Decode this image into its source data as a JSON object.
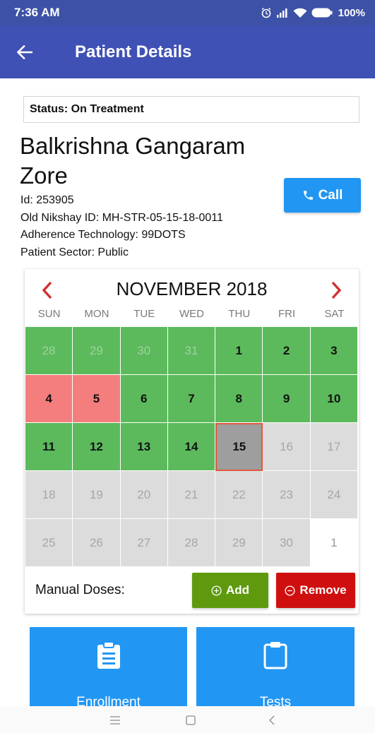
{
  "status_bar": {
    "time": "7:36 AM",
    "battery": "100%"
  },
  "app_bar": {
    "title": "Patient Details",
    "back_icon": "arrow-left-icon"
  },
  "patient": {
    "status": "Status: On Treatment",
    "name": "Balkrishna Gangaram Zore",
    "id": "Id: 253905",
    "old_nikshay_id": "Old Nikshay ID: MH-STR-05-15-18-0011",
    "adherence_technology": "Adherence Technology: 99DOTS",
    "sector": "Patient Sector: Public",
    "call_label": "Call"
  },
  "calendar": {
    "month_label": "NOVEMBER 2018",
    "weekdays": [
      "SUN",
      "MON",
      "TUE",
      "WED",
      "THU",
      "FRI",
      "SAT"
    ],
    "days": [
      {
        "label": "28",
        "state": "green muted"
      },
      {
        "label": "29",
        "state": "green muted"
      },
      {
        "label": "30",
        "state": "green muted"
      },
      {
        "label": "31",
        "state": "green muted"
      },
      {
        "label": "1",
        "state": "green"
      },
      {
        "label": "2",
        "state": "green"
      },
      {
        "label": "3",
        "state": "green"
      },
      {
        "label": "4",
        "state": "red"
      },
      {
        "label": "5",
        "state": "red"
      },
      {
        "label": "6",
        "state": "green"
      },
      {
        "label": "7",
        "state": "green"
      },
      {
        "label": "8",
        "state": "green"
      },
      {
        "label": "9",
        "state": "green"
      },
      {
        "label": "10",
        "state": "green"
      },
      {
        "label": "11",
        "state": "green"
      },
      {
        "label": "12",
        "state": "green"
      },
      {
        "label": "13",
        "state": "green"
      },
      {
        "label": "14",
        "state": "green"
      },
      {
        "label": "15",
        "state": "today"
      },
      {
        "label": "16",
        "state": "gray"
      },
      {
        "label": "17",
        "state": "gray"
      },
      {
        "label": "18",
        "state": "gray"
      },
      {
        "label": "19",
        "state": "gray"
      },
      {
        "label": "20",
        "state": "gray"
      },
      {
        "label": "21",
        "state": "gray"
      },
      {
        "label": "22",
        "state": "gray"
      },
      {
        "label": "23",
        "state": "gray"
      },
      {
        "label": "24",
        "state": "gray"
      },
      {
        "label": "25",
        "state": "gray"
      },
      {
        "label": "26",
        "state": "gray"
      },
      {
        "label": "27",
        "state": "gray"
      },
      {
        "label": "28",
        "state": "gray"
      },
      {
        "label": "29",
        "state": "gray"
      },
      {
        "label": "30",
        "state": "gray"
      },
      {
        "label": "1",
        "state": "white"
      }
    ],
    "manual_doses_label": "Manual Doses:",
    "add_label": "Add",
    "remove_label": "Remove"
  },
  "tiles": [
    {
      "label": "Enrollment",
      "icon": "clipboard-list-icon"
    },
    {
      "label": "Tests",
      "icon": "clipboard-icon"
    }
  ],
  "colors": {
    "app_bar": "#3f51b5",
    "status_bar": "#3d52a6",
    "primary_button": "#2196f3",
    "dose_taken": "#5cba5c",
    "dose_missed": "#f47d7d",
    "future": "#dcdcdc",
    "add_button": "#5f9a0e",
    "remove_button": "#cf0f0f",
    "nav_arrow": "#d32f2f"
  }
}
